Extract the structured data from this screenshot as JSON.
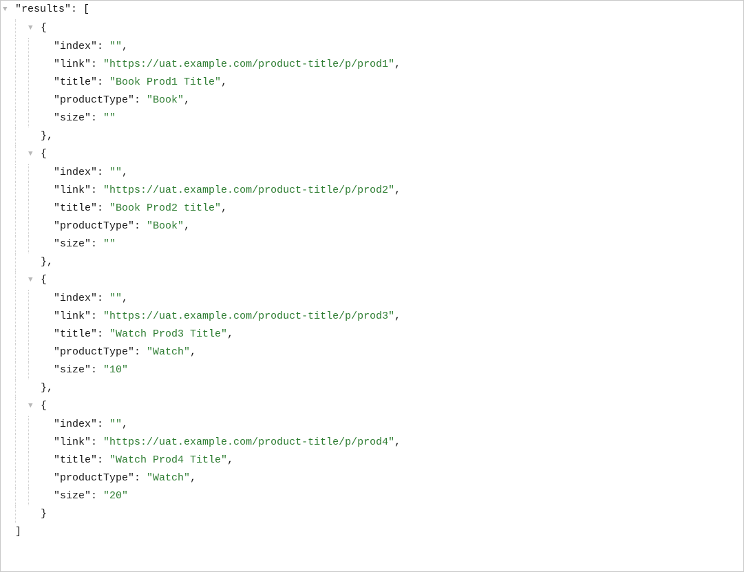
{
  "root_key": "results",
  "items": [
    {
      "index": "",
      "link": "https://uat.example.com/product-title/p/prod1",
      "title": "Book Prod1 Title",
      "productType": "Book",
      "size": ""
    },
    {
      "index": "",
      "link": "https://uat.example.com/product-title/p/prod2",
      "title": "Book Prod2 title",
      "productType": "Book",
      "size": ""
    },
    {
      "index": "",
      "link": "https://uat.example.com/product-title/p/prod3",
      "title": "Watch Prod3 Title",
      "productType": "Watch",
      "size": "10"
    },
    {
      "index": "",
      "link": "https://uat.example.com/product-title/p/prod4",
      "title": "Watch Prod4 Title",
      "productType": "Watch",
      "size": "20"
    }
  ],
  "keys": {
    "index": "index",
    "link": "link",
    "title": "title",
    "productType": "productType",
    "size": "size"
  }
}
